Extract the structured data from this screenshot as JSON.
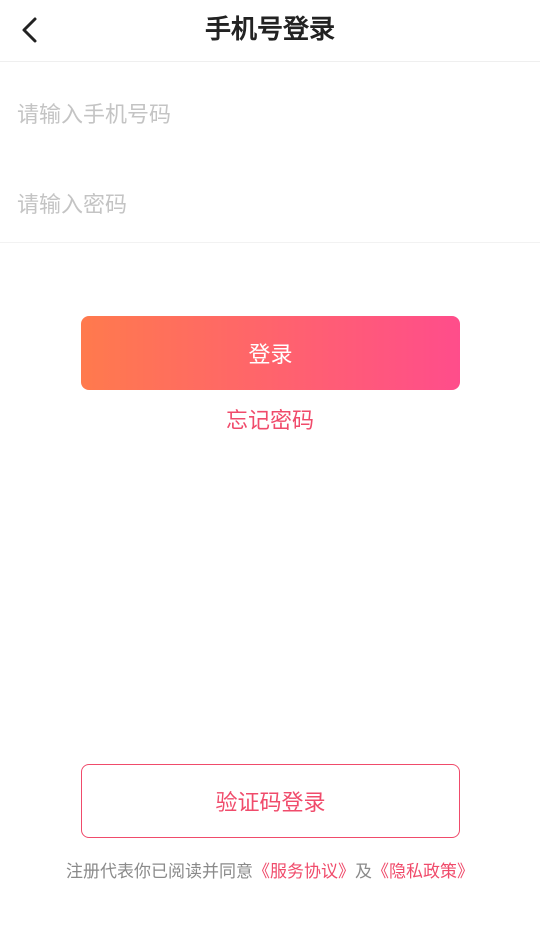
{
  "header": {
    "title": "手机号登录",
    "back_icon": "chevron-left-icon"
  },
  "form": {
    "phone_placeholder": "请输入手机号码",
    "password_placeholder": "请输入密码",
    "login_label": "登录",
    "forgot_label": "忘记密码"
  },
  "footer": {
    "sms_login_label": "验证码登录",
    "agreement_prefix": "注册代表你已阅读并同意",
    "service_link": "《服务协议》",
    "conjunction": "及",
    "privacy_link": "《隐私政策》"
  },
  "colors": {
    "accent": "#f04b6b",
    "gradient_start": "#ff7a4d",
    "gradient_end": "#ff4d8b"
  }
}
